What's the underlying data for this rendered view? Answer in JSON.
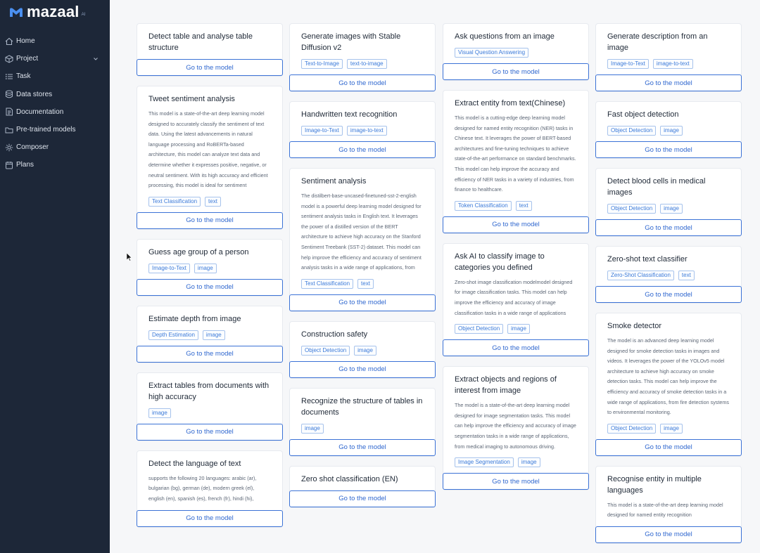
{
  "brand": {
    "name": "mazaal",
    "sup": "AI"
  },
  "nav": [
    {
      "label": "Home",
      "icon": "home-icon"
    },
    {
      "label": "Project",
      "icon": "cube-icon",
      "chevron": true
    },
    {
      "label": "Task",
      "icon": "tasks-icon"
    },
    {
      "label": "Data stores",
      "icon": "database-icon"
    },
    {
      "label": "Documentation",
      "icon": "document-icon"
    },
    {
      "label": "Pre-trained models",
      "icon": "folder-icon"
    },
    {
      "label": "Composer",
      "icon": "composer-icon"
    },
    {
      "label": "Plans",
      "icon": "plans-icon"
    }
  ],
  "button_label": "Go to the model",
  "columns": [
    [
      {
        "title": "Detect table and analyse table structure",
        "desc": "",
        "tags": []
      },
      {
        "title": "Tweet sentiment analysis",
        "desc": "This model is a state-of-the-art deep learning model designed to accurately classify the sentiment of text data. Using the latest advancements in natural language processing and RoBERTa-based architecture, this model can analyze text data and determine whether it expresses positive, negative, or neutral sentiment. With its high accuracy and efficient processing, this model is ideal for sentiment",
        "tags": [
          "Text Classification",
          "text"
        ]
      },
      {
        "title": "Guess age group of a person",
        "desc": "",
        "tags": [
          "Image-to-Text",
          "image"
        ]
      },
      {
        "title": "Estimate depth from image",
        "desc": "",
        "tags": [
          "Depth Estimation",
          "image"
        ]
      },
      {
        "title": "Extract tables from documents with high accuracy",
        "desc": "",
        "tags": [
          "image"
        ]
      },
      {
        "title": "Detect the language of text",
        "desc": "supports the following 20 languages: arabic (ar), bulgarian (bg), german (de), modern greek (el), english (en), spanish (es), french (fr), hindi (hi),",
        "tags": []
      }
    ],
    [
      {
        "title": "Generate images with Stable Diffusion v2",
        "desc": "",
        "tags": [
          "Text-to-Image",
          "text-to-image"
        ]
      },
      {
        "title": "Handwritten text recognition",
        "desc": "",
        "tags": [
          "Image-to-Text",
          "image-to-text"
        ]
      },
      {
        "title": "Sentiment analysis",
        "desc": "The distilbert-base-uncased-finetuned-sst-2-english model is a powerful deep learning model designed for sentiment analysis tasks in English text. It leverages the power of a distilled version of the BERT architecture to achieve high accuracy on the Stanford Sentiment Treebank (SST-2) dataset. This model can help improve the efficiency and accuracy of sentiment analysis tasks in a wide range of applications, from",
        "tags": [
          "Text Classification",
          "text"
        ]
      },
      {
        "title": "Construction safety",
        "desc": "",
        "tags": [
          "Object Detection",
          "image"
        ]
      },
      {
        "title": "Recognize the structure of tables in documents",
        "desc": "",
        "tags": [
          "image"
        ]
      },
      {
        "title": "Zero shot classification (EN)",
        "desc": "",
        "tags": []
      }
    ],
    [
      {
        "title": "Ask questions from an image",
        "desc": "",
        "tags": [
          "Visual Question Answering"
        ]
      },
      {
        "title": "Extract entity from text(Chinese)",
        "desc": "This model is a cutting-edge deep learning model designed for named entity recognition (NER) tasks in Chinese text. It leverages the power of BERT-based architectures and fine-tuning techniques to achieve state-of-the-art performance on standard benchmarks. This model can help improve the accuracy and efficiency of NER tasks in a variety of industries, from finance to healthcare.",
        "tags": [
          "Token Classification",
          "text"
        ]
      },
      {
        "title": "Ask AI to classify image to categories you defined",
        "desc": "Zero-shot image classification modelmodel designed for image classification tasks. This model can help improve the efficiency and accuracy of image classification tasks in a wide range of applications",
        "tags": [
          "Object Detection",
          "image"
        ]
      },
      {
        "title": "Extract objects and regions of interest from image",
        "desc": "The model is a state-of-the-art deep learning model designed for image segmentation tasks. This model can help improve the efficiency and accuracy of image segmentation tasks in a wide range of applications, from medical imaging to autonomous driving.",
        "tags": [
          "Image Segmentation",
          "image"
        ]
      }
    ],
    [
      {
        "title": "Generate description from an image",
        "desc": "",
        "tags": [
          "Image-to-Text",
          "image-to-text"
        ]
      },
      {
        "title": "Fast object detection",
        "desc": "",
        "tags": [
          "Object Detection",
          "image"
        ]
      },
      {
        "title": "Detect blood cells in medical images",
        "desc": "",
        "tags": [
          "Object Detection",
          "image"
        ]
      },
      {
        "title": "Zero-shot text classifier",
        "desc": "",
        "tags": [
          "Zero-Shot Classification",
          "text"
        ]
      },
      {
        "title": "Smoke detector",
        "desc": "The model is an advanced deep learning model designed for smoke detection tasks in images and videos. It leverages the power of the YOLOv5 model architecture to achieve high accuracy on smoke detection tasks. This model can help improve the efficiency and accuracy of smoke detection tasks in a wide range of applications, from fire detection systems to environmental monitoring.",
        "tags": [
          "Object Detection",
          "image"
        ]
      },
      {
        "title": "Recognise entity in multiple languages",
        "desc": "This model is a state-of-the-art deep learning model designed for named entity recognition",
        "tags": []
      }
    ]
  ]
}
